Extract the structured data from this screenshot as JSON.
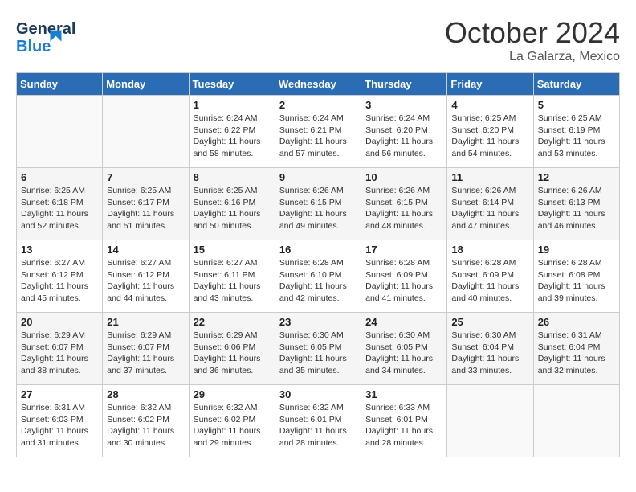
{
  "header": {
    "logo_line1": "General",
    "logo_line2": "Blue",
    "month": "October 2024",
    "location": "La Galarza, Mexico"
  },
  "days_of_week": [
    "Sunday",
    "Monday",
    "Tuesday",
    "Wednesday",
    "Thursday",
    "Friday",
    "Saturday"
  ],
  "weeks": [
    [
      {
        "day": "",
        "sunrise": "",
        "sunset": "",
        "daylight": ""
      },
      {
        "day": "",
        "sunrise": "",
        "sunset": "",
        "daylight": ""
      },
      {
        "day": "1",
        "sunrise": "Sunrise: 6:24 AM",
        "sunset": "Sunset: 6:22 PM",
        "daylight": "Daylight: 11 hours and 58 minutes."
      },
      {
        "day": "2",
        "sunrise": "Sunrise: 6:24 AM",
        "sunset": "Sunset: 6:21 PM",
        "daylight": "Daylight: 11 hours and 57 minutes."
      },
      {
        "day": "3",
        "sunrise": "Sunrise: 6:24 AM",
        "sunset": "Sunset: 6:20 PM",
        "daylight": "Daylight: 11 hours and 56 minutes."
      },
      {
        "day": "4",
        "sunrise": "Sunrise: 6:25 AM",
        "sunset": "Sunset: 6:20 PM",
        "daylight": "Daylight: 11 hours and 54 minutes."
      },
      {
        "day": "5",
        "sunrise": "Sunrise: 6:25 AM",
        "sunset": "Sunset: 6:19 PM",
        "daylight": "Daylight: 11 hours and 53 minutes."
      }
    ],
    [
      {
        "day": "6",
        "sunrise": "Sunrise: 6:25 AM",
        "sunset": "Sunset: 6:18 PM",
        "daylight": "Daylight: 11 hours and 52 minutes."
      },
      {
        "day": "7",
        "sunrise": "Sunrise: 6:25 AM",
        "sunset": "Sunset: 6:17 PM",
        "daylight": "Daylight: 11 hours and 51 minutes."
      },
      {
        "day": "8",
        "sunrise": "Sunrise: 6:25 AM",
        "sunset": "Sunset: 6:16 PM",
        "daylight": "Daylight: 11 hours and 50 minutes."
      },
      {
        "day": "9",
        "sunrise": "Sunrise: 6:26 AM",
        "sunset": "Sunset: 6:15 PM",
        "daylight": "Daylight: 11 hours and 49 minutes."
      },
      {
        "day": "10",
        "sunrise": "Sunrise: 6:26 AM",
        "sunset": "Sunset: 6:15 PM",
        "daylight": "Daylight: 11 hours and 48 minutes."
      },
      {
        "day": "11",
        "sunrise": "Sunrise: 6:26 AM",
        "sunset": "Sunset: 6:14 PM",
        "daylight": "Daylight: 11 hours and 47 minutes."
      },
      {
        "day": "12",
        "sunrise": "Sunrise: 6:26 AM",
        "sunset": "Sunset: 6:13 PM",
        "daylight": "Daylight: 11 hours and 46 minutes."
      }
    ],
    [
      {
        "day": "13",
        "sunrise": "Sunrise: 6:27 AM",
        "sunset": "Sunset: 6:12 PM",
        "daylight": "Daylight: 11 hours and 45 minutes."
      },
      {
        "day": "14",
        "sunrise": "Sunrise: 6:27 AM",
        "sunset": "Sunset: 6:12 PM",
        "daylight": "Daylight: 11 hours and 44 minutes."
      },
      {
        "day": "15",
        "sunrise": "Sunrise: 6:27 AM",
        "sunset": "Sunset: 6:11 PM",
        "daylight": "Daylight: 11 hours and 43 minutes."
      },
      {
        "day": "16",
        "sunrise": "Sunrise: 6:28 AM",
        "sunset": "Sunset: 6:10 PM",
        "daylight": "Daylight: 11 hours and 42 minutes."
      },
      {
        "day": "17",
        "sunrise": "Sunrise: 6:28 AM",
        "sunset": "Sunset: 6:09 PM",
        "daylight": "Daylight: 11 hours and 41 minutes."
      },
      {
        "day": "18",
        "sunrise": "Sunrise: 6:28 AM",
        "sunset": "Sunset: 6:09 PM",
        "daylight": "Daylight: 11 hours and 40 minutes."
      },
      {
        "day": "19",
        "sunrise": "Sunrise: 6:28 AM",
        "sunset": "Sunset: 6:08 PM",
        "daylight": "Daylight: 11 hours and 39 minutes."
      }
    ],
    [
      {
        "day": "20",
        "sunrise": "Sunrise: 6:29 AM",
        "sunset": "Sunset: 6:07 PM",
        "daylight": "Daylight: 11 hours and 38 minutes."
      },
      {
        "day": "21",
        "sunrise": "Sunrise: 6:29 AM",
        "sunset": "Sunset: 6:07 PM",
        "daylight": "Daylight: 11 hours and 37 minutes."
      },
      {
        "day": "22",
        "sunrise": "Sunrise: 6:29 AM",
        "sunset": "Sunset: 6:06 PM",
        "daylight": "Daylight: 11 hours and 36 minutes."
      },
      {
        "day": "23",
        "sunrise": "Sunrise: 6:30 AM",
        "sunset": "Sunset: 6:05 PM",
        "daylight": "Daylight: 11 hours and 35 minutes."
      },
      {
        "day": "24",
        "sunrise": "Sunrise: 6:30 AM",
        "sunset": "Sunset: 6:05 PM",
        "daylight": "Daylight: 11 hours and 34 minutes."
      },
      {
        "day": "25",
        "sunrise": "Sunrise: 6:30 AM",
        "sunset": "Sunset: 6:04 PM",
        "daylight": "Daylight: 11 hours and 33 minutes."
      },
      {
        "day": "26",
        "sunrise": "Sunrise: 6:31 AM",
        "sunset": "Sunset: 6:04 PM",
        "daylight": "Daylight: 11 hours and 32 minutes."
      }
    ],
    [
      {
        "day": "27",
        "sunrise": "Sunrise: 6:31 AM",
        "sunset": "Sunset: 6:03 PM",
        "daylight": "Daylight: 11 hours and 31 minutes."
      },
      {
        "day": "28",
        "sunrise": "Sunrise: 6:32 AM",
        "sunset": "Sunset: 6:02 PM",
        "daylight": "Daylight: 11 hours and 30 minutes."
      },
      {
        "day": "29",
        "sunrise": "Sunrise: 6:32 AM",
        "sunset": "Sunset: 6:02 PM",
        "daylight": "Daylight: 11 hours and 29 minutes."
      },
      {
        "day": "30",
        "sunrise": "Sunrise: 6:32 AM",
        "sunset": "Sunset: 6:01 PM",
        "daylight": "Daylight: 11 hours and 28 minutes."
      },
      {
        "day": "31",
        "sunrise": "Sunrise: 6:33 AM",
        "sunset": "Sunset: 6:01 PM",
        "daylight": "Daylight: 11 hours and 28 minutes."
      },
      {
        "day": "",
        "sunrise": "",
        "sunset": "",
        "daylight": ""
      },
      {
        "day": "",
        "sunrise": "",
        "sunset": "",
        "daylight": ""
      }
    ]
  ]
}
